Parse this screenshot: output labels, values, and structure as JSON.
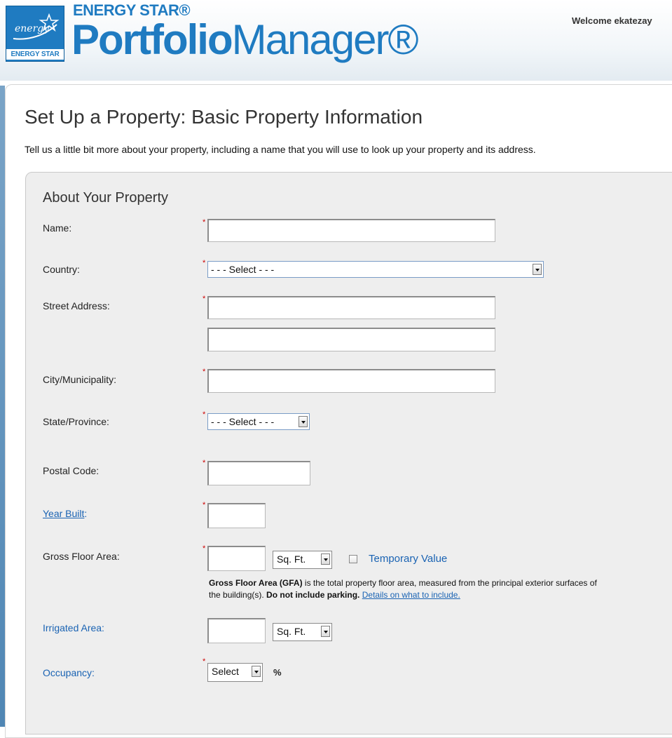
{
  "header": {
    "brand_top": "ENERGY STAR®",
    "brand_portfolio": "Portfolio",
    "brand_manager": "Manager®",
    "logo_label": "ENERGY STAR",
    "logo_script": "energy",
    "welcome_text": "Welcome ekatezay"
  },
  "page": {
    "title": "Set Up a Property: Basic Property Information",
    "description": "Tell us a little bit more about your property, including a name that you will use to look up your property and its address."
  },
  "form": {
    "section_title": "About Your Property",
    "name_label": "Name:",
    "country_label": "Country:",
    "country_value": "- - - Select - - -",
    "street_label": "Street Address:",
    "city_label": "City/Municipality:",
    "state_label": "State/Province:",
    "state_value": "- - - Select - - -",
    "postal_label": "Postal Code:",
    "year_built_label": "Year Built",
    "year_built_colon": ":",
    "gfa_label": "Gross Floor Area:",
    "gfa_unit": "Sq. Ft.",
    "temporary_value_label": "Temporary Value",
    "gfa_note_bold1": "Gross Floor Area (GFA)",
    "gfa_note_text1": " is the total property floor area, measured from the principal exterior surfaces of the building(s). ",
    "gfa_note_bold2": "Do not include parking.",
    "gfa_note_link": "Details on what to include.",
    "irrigated_label": "Irrigated Area:",
    "irrigated_unit": "Sq. Ft.",
    "occupancy_label": "Occupancy:",
    "occupancy_value": "Select",
    "occupancy_unit": "%",
    "required_marker": "*"
  },
  "colors": {
    "brand_blue": "#1f7bc1",
    "link_blue": "#1a63b3",
    "required_red": "#cc0000",
    "panel_gray": "#eeeeee"
  }
}
